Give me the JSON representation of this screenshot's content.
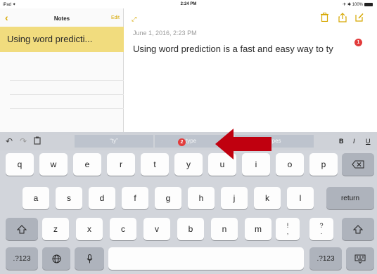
{
  "status": {
    "device": "iPad ✦",
    "time": "2:24 PM",
    "battery": "✈ ✱ 100%"
  },
  "notes": {
    "back_icon": "chevron-left-icon",
    "title": "Notes",
    "edit": "Edit",
    "selected_note": "Using word predicti..."
  },
  "editor": {
    "date": "June 1, 2016, 2:23 PM",
    "body": "Using word prediction is a fast and easy way to ty",
    "badge": "1"
  },
  "keyboard": {
    "predictions": [
      "“ty”",
      "type",
      "types"
    ],
    "prediction_badge": "2",
    "format": {
      "bold": "B",
      "italic": "I",
      "underline": "U"
    },
    "row1": [
      "q",
      "w",
      "e",
      "r",
      "t",
      "y",
      "u",
      "i",
      "o",
      "p"
    ],
    "row2": [
      "a",
      "s",
      "d",
      "f",
      "g",
      "h",
      "j",
      "k",
      "l"
    ],
    "row3": [
      "z",
      "x",
      "c",
      "v",
      "b",
      "n",
      "m"
    ],
    "row3_punct": [
      {
        "top": "!",
        "bottom": ","
      },
      {
        "top": "?",
        "bottom": "."
      }
    ],
    "return_label": "return",
    "numbers_label": ".?123"
  },
  "colors": {
    "accent": "#d6a700",
    "selected_note": "#f1dc7e",
    "arrow": "#c0000f",
    "badge": "#e23b3b"
  }
}
